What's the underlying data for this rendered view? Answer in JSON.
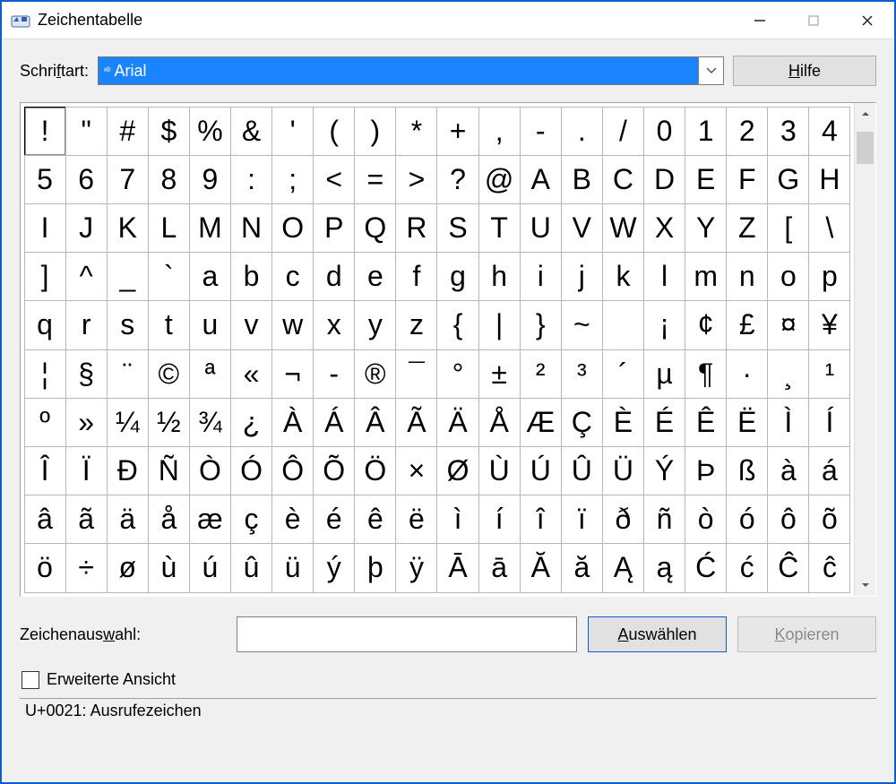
{
  "window": {
    "title": "Zeichentabelle"
  },
  "fontRow": {
    "label_pre": "Schri",
    "label_u": "f",
    "label_post": "tart:",
    "selected": "Arial"
  },
  "help": {
    "label_u": "H",
    "label_post": "ilfe"
  },
  "chars": [
    "!",
    "\"",
    "#",
    "$",
    "%",
    "&",
    "'",
    "(",
    ")",
    "*",
    "+",
    ",",
    "-",
    ".",
    "/",
    "0",
    "1",
    "2",
    "3",
    "4",
    "5",
    "6",
    "7",
    "8",
    "9",
    ":",
    ";",
    "<",
    "=",
    ">",
    "?",
    "@",
    "A",
    "B",
    "C",
    "D",
    "E",
    "F",
    "G",
    "H",
    "I",
    "J",
    "K",
    "L",
    "M",
    "N",
    "O",
    "P",
    "Q",
    "R",
    "S",
    "T",
    "U",
    "V",
    "W",
    "X",
    "Y",
    "Z",
    "[",
    "\\",
    "]",
    "^",
    "_",
    "`",
    "a",
    "b",
    "c",
    "d",
    "e",
    "f",
    "g",
    "h",
    "i",
    "j",
    "k",
    "l",
    "m",
    "n",
    "o",
    "p",
    "q",
    "r",
    "s",
    "t",
    "u",
    "v",
    "w",
    "x",
    "y",
    "z",
    "{",
    "|",
    "}",
    "~",
    " ",
    "¡",
    "¢",
    "£",
    "¤",
    "¥",
    "¦",
    "§",
    "¨",
    "©",
    "ª",
    "«",
    "¬",
    "‑",
    "®",
    "¯",
    "°",
    "±",
    "²",
    "³",
    "´",
    "µ",
    "¶",
    "·",
    "¸",
    "¹",
    "º",
    "»",
    "¼",
    "½",
    "¾",
    "¿",
    "À",
    "Á",
    "Â",
    "Ã",
    "Ä",
    "Å",
    "Æ",
    "Ç",
    "È",
    "É",
    "Ê",
    "Ë",
    "Ì",
    "Í",
    "Î",
    "Ï",
    "Ð",
    "Ñ",
    "Ò",
    "Ó",
    "Ô",
    "Õ",
    "Ö",
    "×",
    "Ø",
    "Ù",
    "Ú",
    "Û",
    "Ü",
    "Ý",
    "Þ",
    "ß",
    "à",
    "á",
    "â",
    "ã",
    "ä",
    "å",
    "æ",
    "ç",
    "è",
    "é",
    "ê",
    "ë",
    "ì",
    "í",
    "î",
    "ï",
    "ð",
    "ñ",
    "ò",
    "ó",
    "ô",
    "õ",
    "ö",
    "÷",
    "ø",
    "ù",
    "ú",
    "û",
    "ü",
    "ý",
    "þ",
    "ÿ",
    "Ā",
    "ā",
    "Ă",
    "ă",
    "Ą",
    "ą",
    "Ć",
    "ć",
    "Ĉ",
    "ĉ"
  ],
  "selectedIndex": 0,
  "selection": {
    "label_pre": "Zeichenaus",
    "label_u": "w",
    "label_post": "ahl:",
    "value": ""
  },
  "buttons": {
    "select_u": "A",
    "select_post": "uswählen",
    "copy_u": "K",
    "copy_post": "opieren"
  },
  "advanced": {
    "label": "Erweiterte Ansicht",
    "checked": false
  },
  "status": "U+0021: Ausrufezeichen"
}
